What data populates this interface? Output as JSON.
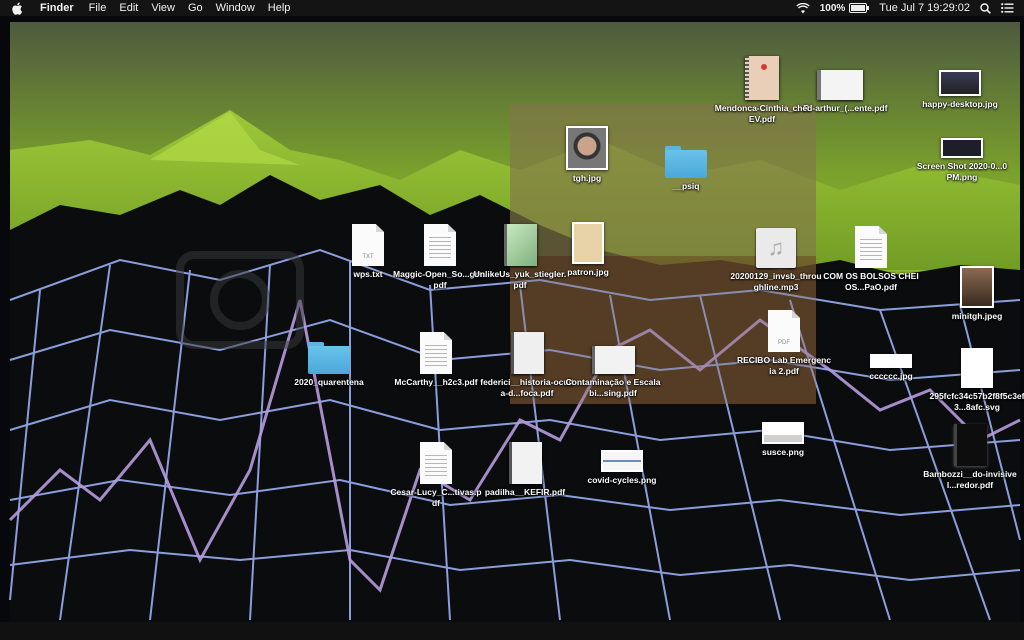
{
  "menubar": {
    "app": "Finder",
    "menus": [
      "File",
      "Edit",
      "View",
      "Go",
      "Window",
      "Help"
    ],
    "battery": "100%",
    "battery_level": 1.0,
    "clock": "Tue Jul 7  19:29:02",
    "icons": [
      "apple-icon",
      "wifi-icon",
      "battery-icon",
      "spotlight-icon",
      "notification-center-icon"
    ]
  },
  "desktop": {
    "items": [
      {
        "name": "Mendonca-Cinthia_...-REV.pdf",
        "type": "pdf"
      },
      {
        "name": "ched-arthur_(...ente.pdf",
        "type": "pdf"
      },
      {
        "name": "happy-desktop.jpg",
        "type": "image"
      },
      {
        "name": "tgh.jpg",
        "type": "image"
      },
      {
        "name": "__psiq",
        "type": "folder"
      },
      {
        "name": "Screen Shot 2020-0...0 PM.png",
        "type": "image"
      },
      {
        "name": "wps.txt",
        "type": "txt"
      },
      {
        "name": "Maggic-Open_So...gen.pdf",
        "type": "pdf"
      },
      {
        "name": "UnlikeUs_yuk_stiegler.pdf",
        "type": "pdf"
      },
      {
        "name": "patron.jpg",
        "type": "image"
      },
      {
        "name": "20200129_invsb_throughline.mp3",
        "type": "audio"
      },
      {
        "name": "COM OS BOLSOS CHEIOS...PaO.pdf",
        "type": "pdf"
      },
      {
        "name": "minitgh.jpeg",
        "type": "image"
      },
      {
        "name": "2020_quarentena",
        "type": "folder"
      },
      {
        "name": "McCarthy__h2c3.pdf",
        "type": "pdf"
      },
      {
        "name": "federici__historia-oculta-d...foca.pdf",
        "type": "pdf"
      },
      {
        "name": "Contaminação e Escalabi...sing.pdf",
        "type": "pdf"
      },
      {
        "name": "RECIBO Lab Emergencia 2.pdf",
        "type": "pdf"
      },
      {
        "name": "cccccc.jpg",
        "type": "image"
      },
      {
        "name": "295fcfc34c57b2f8f5c3ef3...8afc.svg",
        "type": "svg"
      },
      {
        "name": "susce.png",
        "type": "image"
      },
      {
        "name": "Bambozzi__do-invisivel...redor.pdf",
        "type": "pdf"
      },
      {
        "name": "Cesar-Lucy_C...tivas.pdf",
        "type": "pdf"
      },
      {
        "name": "padilha__KEFIR.pdf",
        "type": "pdf"
      },
      {
        "name": "covid-cycles.png",
        "type": "image"
      }
    ]
  },
  "colors": {
    "menubar": "#141414",
    "folder": "#5eb4e0",
    "wallpaper_green": "#8fbe2a",
    "grid_lines": "#9aaef2",
    "graph_line": "#b79bde"
  }
}
